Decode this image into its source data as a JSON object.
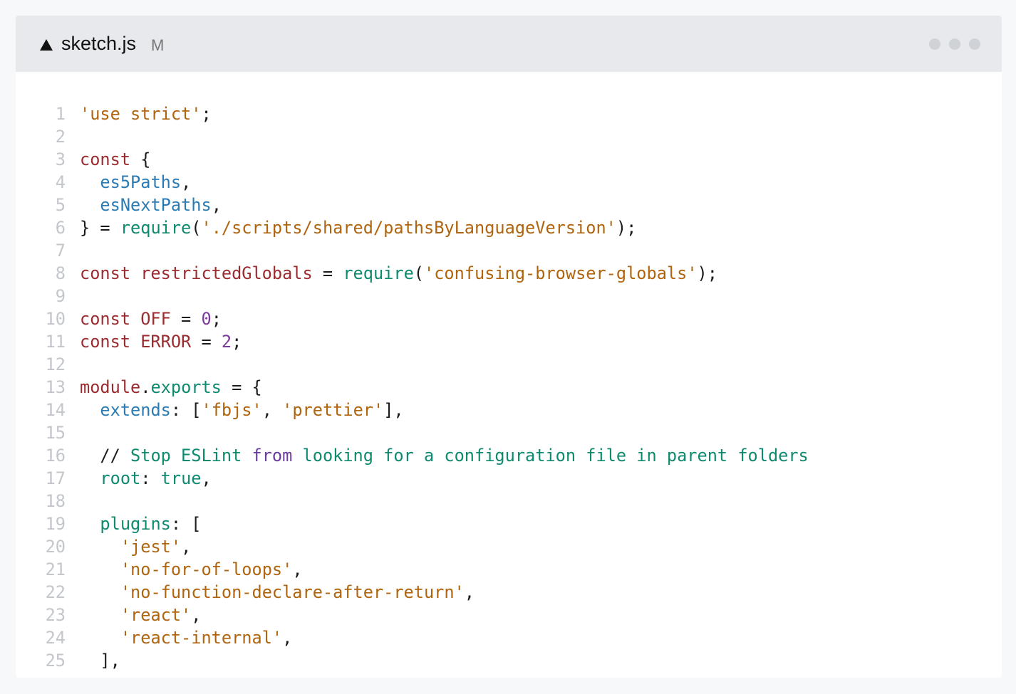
{
  "titlebar": {
    "filename": "sketch.js",
    "status": "M",
    "icon": "triangle-icon",
    "menu_icon": "more-dots-icon"
  },
  "code": {
    "lines": [
      {
        "n": "1",
        "tokens": [
          [
            "str",
            "'use strict'"
          ],
          [
            "pun",
            ";"
          ]
        ]
      },
      {
        "n": "2",
        "tokens": []
      },
      {
        "n": "3",
        "tokens": [
          [
            "kw",
            "const"
          ],
          [
            "pun",
            " {"
          ]
        ]
      },
      {
        "n": "4",
        "tokens": [
          [
            "pun",
            "  "
          ],
          [
            "var",
            "es5Paths"
          ],
          [
            "pun",
            ","
          ]
        ]
      },
      {
        "n": "5",
        "tokens": [
          [
            "pun",
            "  "
          ],
          [
            "var",
            "esNextPaths"
          ],
          [
            "pun",
            ","
          ]
        ]
      },
      {
        "n": "6",
        "tokens": [
          [
            "pun",
            "} = "
          ],
          [
            "fn",
            "require"
          ],
          [
            "pun",
            "("
          ],
          [
            "str",
            "'./scripts/shared/pathsByLanguageVersion'"
          ],
          [
            "pun",
            ");"
          ]
        ]
      },
      {
        "n": "7",
        "tokens": []
      },
      {
        "n": "8",
        "tokens": [
          [
            "kw",
            "const restrictedGlobals"
          ],
          [
            "pun",
            " = "
          ],
          [
            "fn",
            "require"
          ],
          [
            "pun",
            "("
          ],
          [
            "str",
            "'confusing-browser-globals'"
          ],
          [
            "pun",
            ");"
          ]
        ]
      },
      {
        "n": "9",
        "tokens": []
      },
      {
        "n": "10",
        "tokens": [
          [
            "kw",
            "const OFF"
          ],
          [
            "pun",
            " = "
          ],
          [
            "num",
            "0"
          ],
          [
            "pun",
            ";"
          ]
        ]
      },
      {
        "n": "11",
        "tokens": [
          [
            "kw",
            "const ERROR"
          ],
          [
            "pun",
            " = "
          ],
          [
            "num",
            "2"
          ],
          [
            "pun",
            ";"
          ]
        ]
      },
      {
        "n": "12",
        "tokens": []
      },
      {
        "n": "13",
        "tokens": [
          [
            "kw",
            "module"
          ],
          [
            "pun",
            "."
          ],
          [
            "fn",
            "exports"
          ],
          [
            "pun",
            " = {"
          ]
        ]
      },
      {
        "n": "14",
        "tokens": [
          [
            "pun",
            "  "
          ],
          [
            "var",
            "extends"
          ],
          [
            "pun",
            ": ["
          ],
          [
            "str",
            "'fbjs'"
          ],
          [
            "pun",
            ", "
          ],
          [
            "str",
            "'prettier'"
          ],
          [
            "pun",
            "],"
          ]
        ]
      },
      {
        "n": "15",
        "tokens": []
      },
      {
        "n": "16",
        "tokens": [
          [
            "pun",
            "  // "
          ],
          [
            "cmt",
            "Stop ESLint "
          ],
          [
            "cmk",
            "from"
          ],
          [
            "cmt",
            " looking for a configuration file in parent folders"
          ]
        ]
      },
      {
        "n": "17",
        "tokens": [
          [
            "pun",
            "  "
          ],
          [
            "fn",
            "root"
          ],
          [
            "pun",
            ": "
          ],
          [
            "fn",
            "true"
          ],
          [
            "pun",
            ","
          ]
        ]
      },
      {
        "n": "18",
        "tokens": []
      },
      {
        "n": "19",
        "tokens": [
          [
            "pun",
            "  "
          ],
          [
            "fn",
            "plugins"
          ],
          [
            "pun",
            ": ["
          ]
        ]
      },
      {
        "n": "20",
        "tokens": [
          [
            "pun",
            "    "
          ],
          [
            "str",
            "'jest'"
          ],
          [
            "pun",
            ","
          ]
        ]
      },
      {
        "n": "21",
        "tokens": [
          [
            "pun",
            "    "
          ],
          [
            "str",
            "'no-for-of-loops'"
          ],
          [
            "pun",
            ","
          ]
        ]
      },
      {
        "n": "22",
        "tokens": [
          [
            "pun",
            "    "
          ],
          [
            "str",
            "'no-function-declare-after-return'"
          ],
          [
            "pun",
            ","
          ]
        ]
      },
      {
        "n": "23",
        "tokens": [
          [
            "pun",
            "    "
          ],
          [
            "str",
            "'react'"
          ],
          [
            "pun",
            ","
          ]
        ]
      },
      {
        "n": "24",
        "tokens": [
          [
            "pun",
            "    "
          ],
          [
            "str",
            "'react-internal'"
          ],
          [
            "pun",
            ","
          ]
        ]
      },
      {
        "n": "25",
        "tokens": [
          [
            "pun",
            "  ],"
          ]
        ]
      }
    ]
  }
}
